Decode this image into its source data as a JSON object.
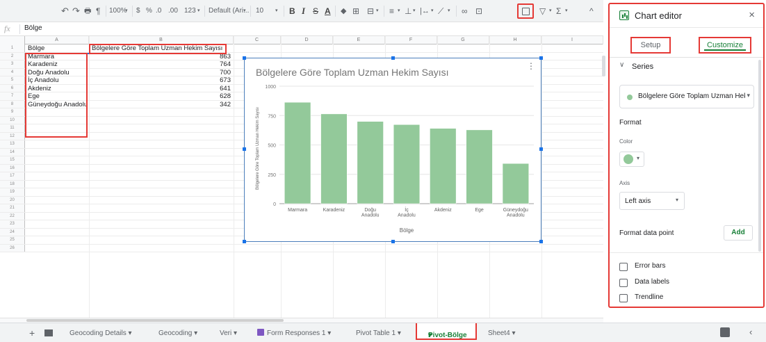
{
  "toolbar": {
    "undo": "↶",
    "redo": "↷",
    "print": "🖶",
    "paint_format": "¶",
    "zoom": "100%",
    "currency": "$",
    "percent": "%",
    "decrease_decimals": ".0",
    "increase_decimals": ".00",
    "more_formats": "123",
    "font": "Default (Ari...",
    "font_size": "10",
    "bold": "B",
    "italic": "I",
    "strikethrough": "S",
    "text_color": "A",
    "fill_color": "◆",
    "borders": "⊞",
    "merge": "⊟",
    "halign": "≡",
    "valign": "⊥",
    "wrap": "|↔",
    "rotate": "⟋",
    "link": "∞",
    "comment": "⊡",
    "chart": "",
    "filter": "▽",
    "functions": "Σ",
    "collapse": "^"
  },
  "formula_bar": {
    "fx": "fx",
    "value": "Bölge"
  },
  "columns": [
    "A",
    "B",
    "C",
    "D",
    "E",
    "F",
    "G",
    "H",
    "I"
  ],
  "sheet_rows": [
    {
      "n": "1",
      "a": "Bölge",
      "b": "Bölgelere Göre Toplam Uzman Hekim Sayısı"
    },
    {
      "n": "2",
      "a": "Marmara",
      "b": "863"
    },
    {
      "n": "3",
      "a": "Karadeniz",
      "b": "764"
    },
    {
      "n": "4",
      "a": "Doğu Anadolu",
      "b": "700"
    },
    {
      "n": "5",
      "a": "İç Anadolu",
      "b": "673"
    },
    {
      "n": "6",
      "a": "Akdeniz",
      "b": "641"
    },
    {
      "n": "7",
      "a": "Ege",
      "b": "628"
    },
    {
      "n": "8",
      "a": "Güneydoğu Anadolu",
      "b": "342"
    },
    {
      "n": "9",
      "a": "",
      "b": ""
    },
    {
      "n": "10",
      "a": "",
      "b": ""
    },
    {
      "n": "11",
      "a": "",
      "b": ""
    },
    {
      "n": "12",
      "a": "",
      "b": ""
    },
    {
      "n": "13",
      "a": "",
      "b": ""
    },
    {
      "n": "14",
      "a": "",
      "b": ""
    },
    {
      "n": "15",
      "a": "",
      "b": ""
    },
    {
      "n": "16",
      "a": "",
      "b": ""
    },
    {
      "n": "17",
      "a": "",
      "b": ""
    },
    {
      "n": "18",
      "a": "",
      "b": ""
    },
    {
      "n": "19",
      "a": "",
      "b": ""
    },
    {
      "n": "20",
      "a": "",
      "b": ""
    },
    {
      "n": "21",
      "a": "",
      "b": ""
    },
    {
      "n": "22",
      "a": "",
      "b": ""
    },
    {
      "n": "23",
      "a": "",
      "b": ""
    },
    {
      "n": "24",
      "a": "",
      "b": ""
    },
    {
      "n": "25",
      "a": "",
      "b": ""
    },
    {
      "n": "26",
      "a": "",
      "b": ""
    }
  ],
  "chart_data": {
    "type": "bar",
    "title": "Bölgelere Göre Toplam Uzman Hekim Sayısı",
    "xlabel": "Bölge",
    "ylabel": "Bölgelere Göre Toplam Uzman Hekim Sayısı",
    "categories": [
      "Marmara",
      "Karadeniz",
      "Doğu Anadolu",
      "İç Anadolu",
      "Akdeniz",
      "Ege",
      "Güneydoğu Anadolu"
    ],
    "series": [
      {
        "name": "Bölgelere Göre Toplam Uzman Hekim Sayısı",
        "values": [
          863,
          764,
          700,
          673,
          641,
          628,
          342
        ]
      }
    ],
    "ylim": [
      0,
      1000
    ],
    "yticks": [
      0,
      250,
      500,
      750,
      1000
    ],
    "grid": true,
    "bar_color": "#93c99a"
  },
  "chart_menu": "⋮",
  "editor": {
    "title": "Chart editor",
    "close": "×",
    "tab_setup": "Setup",
    "tab_customize": "Customize",
    "series_section": "Series",
    "series_chevron": "∨",
    "series_selected": "Bölgelere Göre Toplam Uzman Hekim Sayısı",
    "dropdown_caret": "▾",
    "format_heading": "Format",
    "color_label": "Color",
    "color_value": "#93c99a",
    "axis_label": "Axis",
    "axis_value": "Left axis",
    "format_data_point": "Format data point",
    "add_button": "Add",
    "error_bars": "Error bars",
    "data_labels": "Data labels",
    "trendline": "Trendline"
  },
  "sheet_tabs": [
    {
      "label": "Geocoding Details"
    },
    {
      "label": "Geocoding"
    },
    {
      "label": "Veri"
    },
    {
      "label": "Form Responses 1"
    },
    {
      "label": "Pivot Table 1"
    },
    {
      "label": "Pivot-Bölge",
      "active": true
    },
    {
      "label": "Sheet4"
    }
  ],
  "tab_caret": "▾",
  "add_sheet": "+",
  "collapse_panel": "‹",
  "accent_green": "#188038",
  "highlight_red": "#e53935"
}
